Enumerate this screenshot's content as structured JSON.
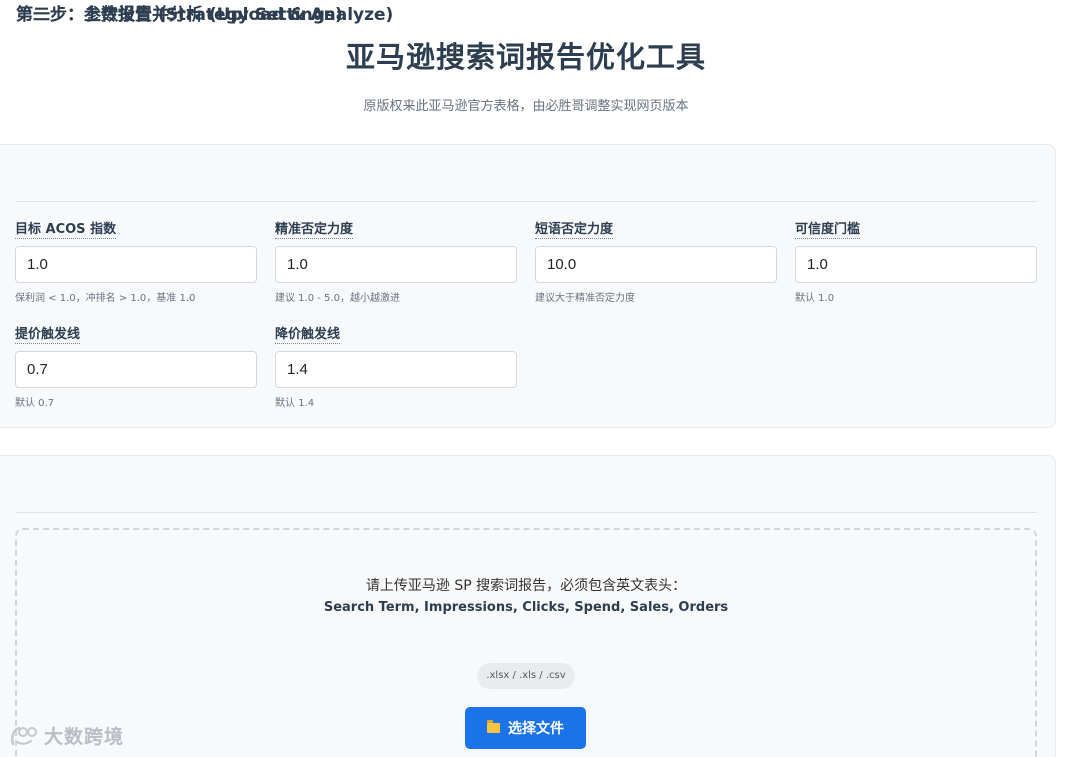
{
  "page": {
    "title": "亚马逊搜索词报告优化工具",
    "subtitle": "原版权来此亚马逊官方表格，由必胜哥调整实现网页版本"
  },
  "step1": {
    "title": "第一步：参数设置 (Strategy Settings)",
    "fields": [
      {
        "label": "目标 ACOS 指数",
        "value": "1.0",
        "hint": "保利润 < 1.0，冲排名 > 1.0，基准 1.0"
      },
      {
        "label": "精准否定力度",
        "value": "1.0",
        "hint": "建议 1.0 - 5.0，越小越激进"
      },
      {
        "label": "短语否定力度",
        "value": "10.0",
        "hint": "建议大于精准否定力度"
      },
      {
        "label": "可信度门槛",
        "value": "1.0",
        "hint": "默认 1.0"
      },
      {
        "label": "提价触发线",
        "value": "0.7",
        "hint": "默认 0.7"
      },
      {
        "label": "降价触发线",
        "value": "1.4",
        "hint": "默认 1.4"
      }
    ]
  },
  "step2": {
    "title": "第二步：上传报告并分析 (Upload & Analyze)",
    "instruction": "请上传亚马逊 SP 搜索词报告，必须包含英文表头：",
    "required_headers": "Search Term, Impressions, Clicks, Spend, Sales, Orders",
    "formats": ".xlsx / .xls / .csv",
    "button_label": "选择文件",
    "button_icon": "folder-icon"
  },
  "watermark": {
    "text": "大数跨境"
  },
  "colors": {
    "accent": "#1a73e8",
    "card_bg": "#f8f9fa",
    "text_dark": "#2c3e50"
  }
}
